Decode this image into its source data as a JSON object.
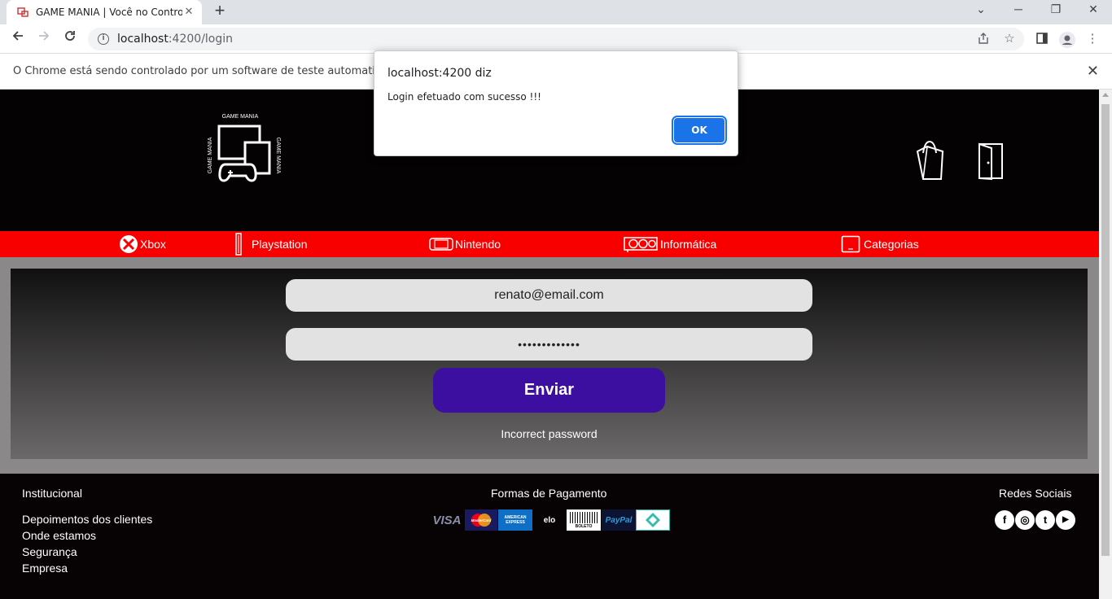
{
  "browser": {
    "tab_title": "GAME MANIA | Você no Controle",
    "tab_close": "✕",
    "new_tab": "+",
    "url_host": "localhost",
    "url_rest": ":4200/login",
    "infobar_message": "O Chrome está sendo controlado por um software de teste automatizado.",
    "infobar_close": "✕"
  },
  "dialog": {
    "title": "localhost:4200 diz",
    "message": "Login efetuado com sucesso !!!",
    "ok_label": "OK"
  },
  "header": {
    "logo_top_text": "GAME MANIA",
    "logo_side_text": "GAME MANIA"
  },
  "nav": {
    "items": [
      {
        "label": "Xbox",
        "icon": "xbox-icon"
      },
      {
        "label": "Playstation",
        "icon": "playstation-icon"
      },
      {
        "label": "Nintendo",
        "icon": "nintendo-icon"
      },
      {
        "label": "Informática",
        "icon": "gpu-icon"
      },
      {
        "label": "Categorias",
        "icon": "tablet-icon"
      }
    ]
  },
  "login": {
    "email_value": "renato@email.com",
    "password_value": "•••••••••••••",
    "submit_label": "Enviar",
    "error_message": "Incorrect password"
  },
  "footer": {
    "institutional_title": "Institucional",
    "institutional_links": [
      "Depoimentos dos clientes",
      "Onde estamos",
      "Segurança",
      "Empresa"
    ],
    "payment_title": "Formas de Pagamento",
    "payment_methods": [
      "VISA",
      "MasterCard",
      "AMERICAN EXPRESS",
      "elo",
      "BOLETO",
      "PayPal",
      "pix"
    ],
    "social_title": "Redes Sociais",
    "social_networks": [
      "f",
      "◎",
      "t",
      "▶"
    ]
  },
  "colors": {
    "nav_bar": "#f90000",
    "submit_button": "#3c0fa1",
    "dialog_ok": "#1a73e8"
  }
}
